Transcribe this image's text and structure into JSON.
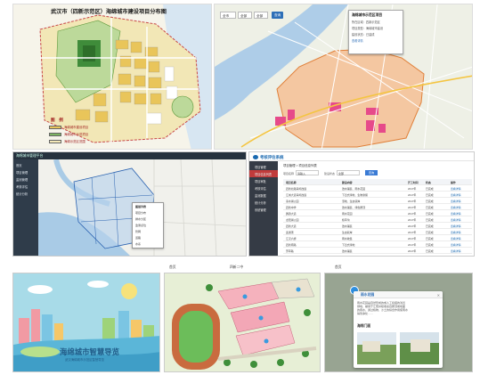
{
  "planning_map": {
    "title": "武汉市（四新示范区）海绵城市建设项目分布图",
    "legend_title": "图　例",
    "legend_items": [
      {
        "label": "海绵城市建设项目",
        "color": "#e9c55a"
      },
      {
        "label": "海绵城市示范项目",
        "color": "#7cb361"
      },
      {
        "label": "海绵示范区范围",
        "color": "#f5e9b8"
      }
    ]
  },
  "gis_map": {
    "selects": [
      "全市",
      "全部",
      "全部"
    ],
    "button": "查询",
    "popup": {
      "title": "海绵城市示范区项目",
      "lines": [
        "所在区域：四新示范区",
        "项目类型：海绵城市建设",
        "建设状态：已建成",
        "查看详情"
      ]
    }
  },
  "admin_map": {
    "brand": "海绵城市管理平台",
    "sidebar": [
      "首页",
      "项目管理",
      "监测管理",
      "考核评估",
      "统计分析"
    ],
    "layers": [
      "图层列表",
      "项目分布",
      "排水分区",
      "监测点位",
      "管网",
      "道路",
      "水系"
    ]
  },
  "assessment": {
    "brand": "考核评估系统",
    "breadcrumb": "项目管理 > 项目信息列表",
    "sidebar": [
      "项目管理",
      "项目信息列表",
      "项目审批",
      "考核评估",
      "监测数据",
      "统计分析",
      "系统管理"
    ],
    "filters": {
      "label1": "项目名称",
      "value1": "请输入",
      "label2": "建设状态",
      "value2": "全部",
      "button": "查询"
    },
    "columns": [
      "项目名称",
      "建设内容",
      "开工时间",
      "状态",
      "操作"
    ],
    "rows": [
      [
        "四新北路海绵改造",
        "透水铺装、雨水花园",
        "2017年",
        "已完成",
        "查看详情"
      ],
      [
        "江城大道海绵改造",
        "下凹式绿地、生物滞留",
        "2017年",
        "已完成",
        "查看详情"
      ],
      [
        "墨水湖公园",
        "湿地、生态驳岸",
        "2017年",
        "已完成",
        "查看详情"
      ],
      [
        "四新中学",
        "透水铺装、绿色屋顶",
        "2017年",
        "已完成",
        "查看详情"
      ],
      [
        "鹦鹉大道",
        "雨水花园",
        "2017年",
        "已完成",
        "查看详情"
      ],
      [
        "龙阳湖公园",
        "植草沟",
        "2017年",
        "已完成",
        "查看详情"
      ],
      [
        "四新大道",
        "透水铺装",
        "2017年",
        "已完成",
        "查看详情"
      ],
      [
        "连通港",
        "生态驳岸",
        "2017年",
        "已完成",
        "查看详情"
      ],
      [
        "江汉六桥",
        "雨水收集",
        "2017年",
        "已完成",
        "查看详情"
      ],
      [
        "四新南路",
        "下凹式绿地",
        "2017年",
        "已完成",
        "查看详情"
      ],
      [
        "芳草路",
        "透水铺装",
        "2017年",
        "已完成",
        "查看详情"
      ],
      [
        "王家湾",
        "雨水花园",
        "2017年",
        "已完成",
        "查看详情"
      ]
    ]
  },
  "guide": {
    "top_label": "首页",
    "title": "海绵城市智慧导览",
    "subtitle": "武汉海绵城市示范区智慧导览"
  },
  "campus": {
    "top_label": "四新二中"
  },
  "detail": {
    "top_label": "首页",
    "card_title": "雨水花园",
    "card_text": [
      "雨水花园是自然形成的或人工挖掘的浅凹",
      "绿地，被用于汇聚并吸收来自屋顶或地面",
      "的雨水，通过植物、沙土的综合作用使雨水",
      "得到净化……"
    ],
    "card_subtitle": "海绵门面"
  }
}
